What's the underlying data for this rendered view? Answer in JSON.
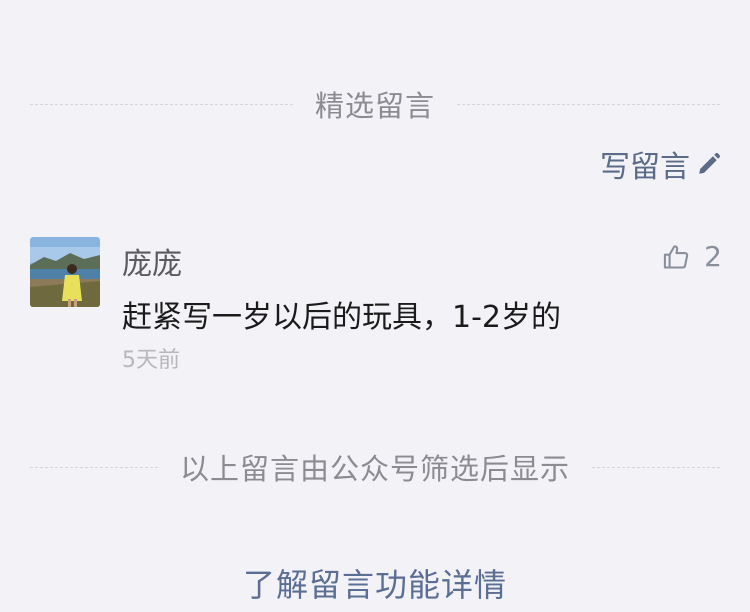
{
  "header": {
    "section_title": "精选留言",
    "write_label": "写留言",
    "write_icon": "pencil-icon"
  },
  "comments": [
    {
      "name": "庞庞",
      "text": "赶紧写一岁以后的玩具，1-2岁的",
      "time": "5天前",
      "likes": "2",
      "like_icon": "thumbs-up-icon"
    }
  ],
  "footer": {
    "note": "以上留言由公众号筛选后显示",
    "learn_more": "了解留言功能详情"
  },
  "colors": {
    "background": "#f3f2f6",
    "link": "#5b6e94",
    "muted": "#8b8b91"
  }
}
